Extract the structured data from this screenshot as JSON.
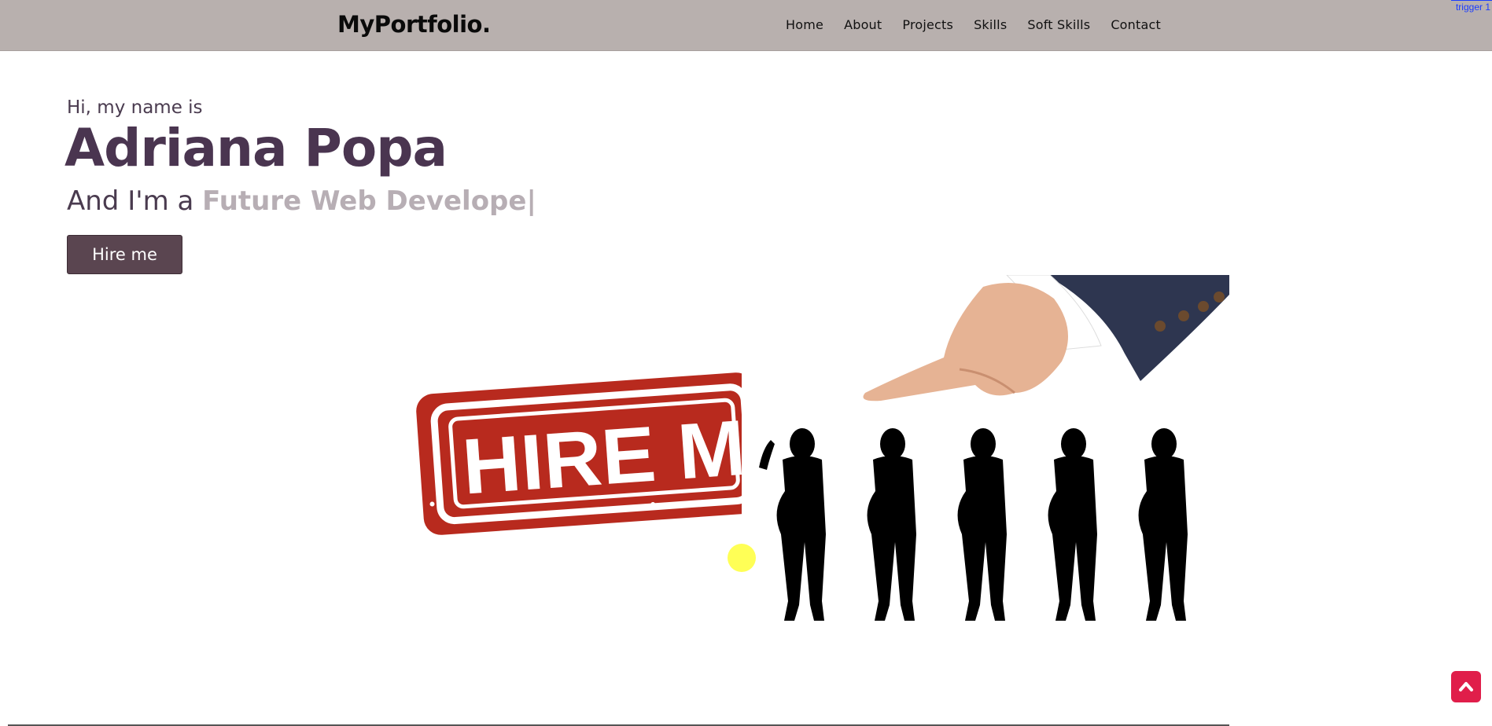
{
  "navbar": {
    "logo": "MyPortfolio.",
    "items": [
      {
        "label": "Home"
      },
      {
        "label": "About"
      },
      {
        "label": "Projects"
      },
      {
        "label": "Skills"
      },
      {
        "label": "Soft Skills"
      },
      {
        "label": "Contact"
      }
    ],
    "trigger_label": "trigger 1"
  },
  "hero": {
    "greeting": "Hi, my name is",
    "name": "Adriana Popa",
    "role_prefix": "And I'm a ",
    "role_typed": "Future Web Develope|",
    "hire_button": "Hire me",
    "stamp_text": "HIRE M"
  },
  "icons": {
    "scroll_top": "arrow-up-icon"
  },
  "colors": {
    "navbar_bg": "#b8b0ae",
    "name": "#4a3550",
    "typed_text": "#b7aeb4",
    "button_bg": "#5a4550",
    "scroll_top_bg": "#e01e4a",
    "stamp_red": "#b82a1e",
    "cursor_highlight": "#ffff44"
  }
}
